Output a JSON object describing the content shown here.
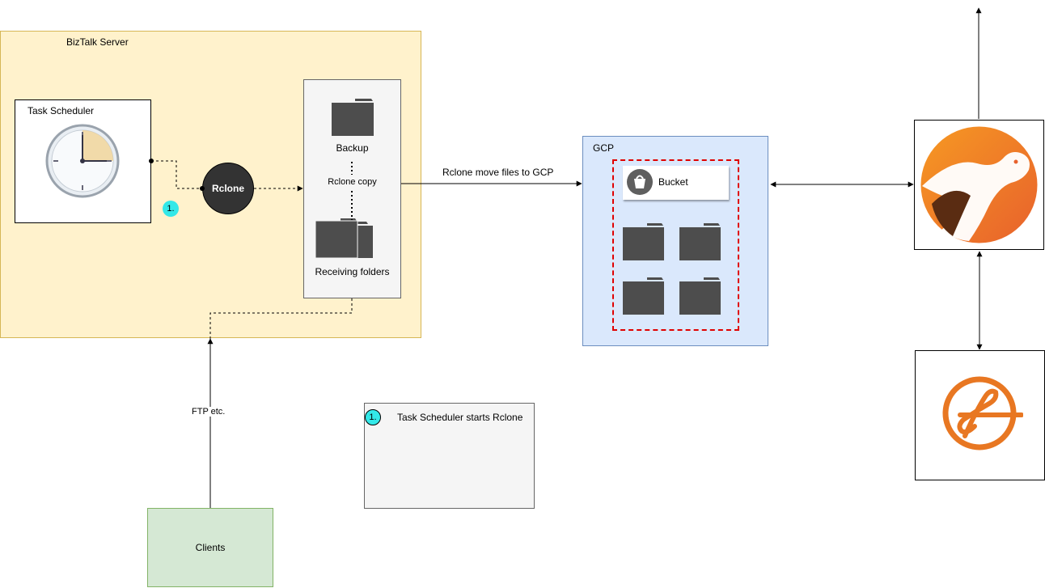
{
  "biztalk": {
    "title": "BizTalk Server"
  },
  "task_scheduler": {
    "title": "Task Scheduler"
  },
  "rclone_node": {
    "label": "Rclone"
  },
  "step_badge": {
    "label": "1."
  },
  "folders": {
    "backup_label": "Backup",
    "copy_label": "Rclone copy",
    "receiving_label": "Receiving folders"
  },
  "edges": {
    "move_label": "Rclone move files to GCP",
    "ftp_label": "FTP etc."
  },
  "gcp": {
    "title": "GCP",
    "bucket_label": "Bucket"
  },
  "legend": {
    "badge": "1.",
    "text": "Task Scheduler starts Rclone"
  },
  "clients": {
    "label": "Clients"
  },
  "icons": {
    "clock": "clock-icon",
    "folder": "folder-icon",
    "bucket": "bucket-icon",
    "camel": "apache-camel-logo",
    "flink": "apache-flink-logo"
  },
  "colors": {
    "biztalk_fill": "#fff2cc",
    "gcp_fill": "#dae8fc",
    "clients_fill": "#d5e8d4",
    "badge": "#33e8e8",
    "bucket_border": "#e00000"
  }
}
